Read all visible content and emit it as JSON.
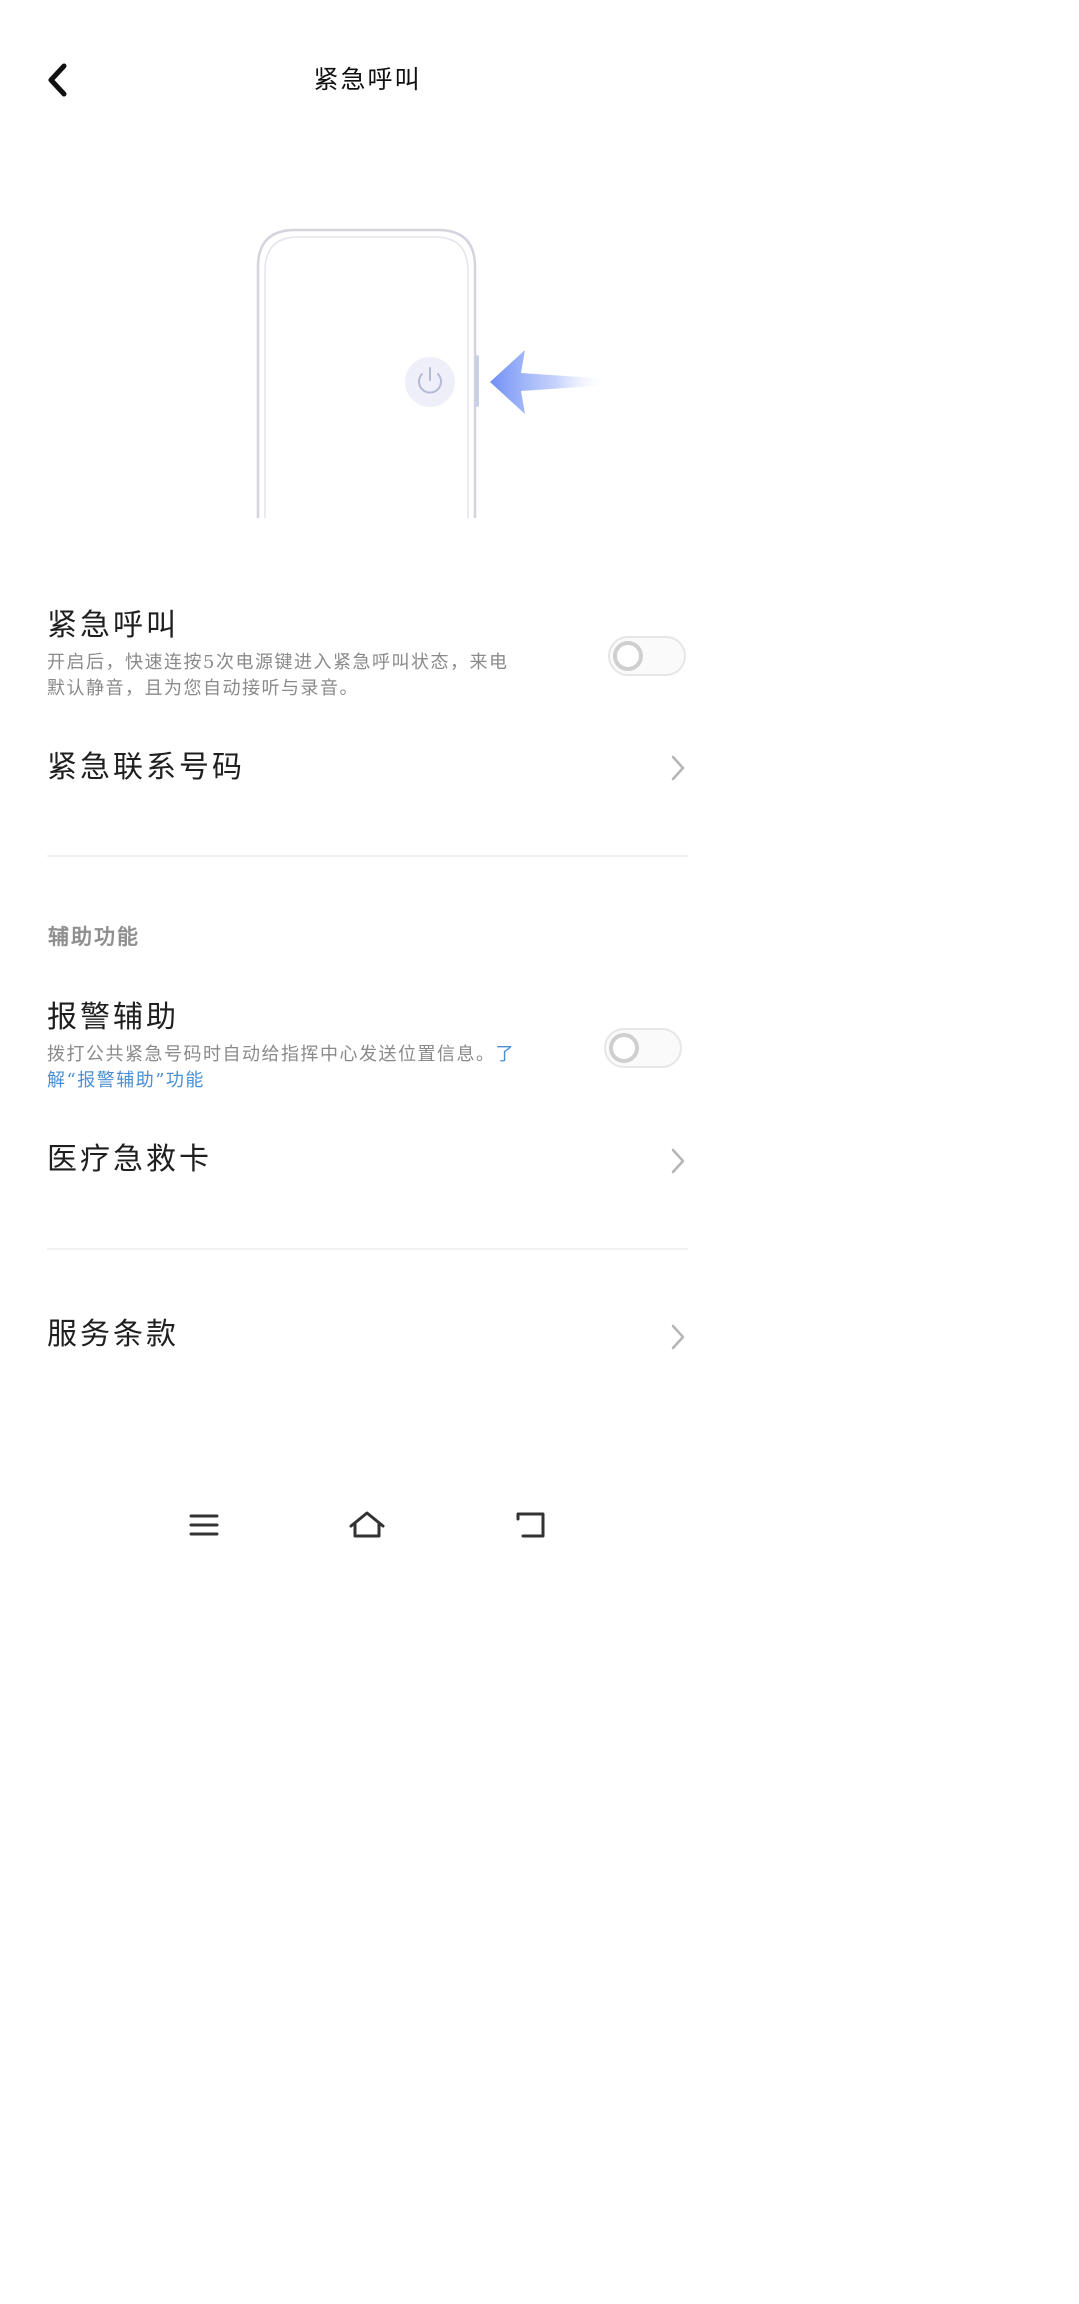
{
  "header": {
    "back_icon": "chevron-left-icon",
    "title": "紧急呼叫"
  },
  "illustration": {
    "power_icon": "power-icon",
    "arrow_icon": "arrow-left-icon",
    "accent_color": "#6f8ff5"
  },
  "emergency_call": {
    "title": "紧急呼叫",
    "description": "开启后，快速连按5次电源键进入紧急呼叫状态，来电默认静音，且为您自动接听与录音。",
    "enabled": false
  },
  "emergency_contacts": {
    "title": "紧急联系号码"
  },
  "accessibility_section": {
    "header": "辅助功能"
  },
  "alarm_assist": {
    "title": "报警辅助",
    "description": "拨打公共紧急号码时自动给指挥中心发送位置信息。",
    "link_text": "了解“报警辅助”功能",
    "enabled": false
  },
  "medical_card": {
    "title": "医疗急救卡"
  },
  "terms": {
    "title": "服务条款"
  },
  "navbar": {
    "menu_icon": "menu-icon",
    "home_icon": "home-icon",
    "back_icon": "back-icon"
  },
  "colors": {
    "link": "#4a8fd4",
    "secondary_text": "#8a8a8a",
    "divider": "#f1f1f1"
  }
}
